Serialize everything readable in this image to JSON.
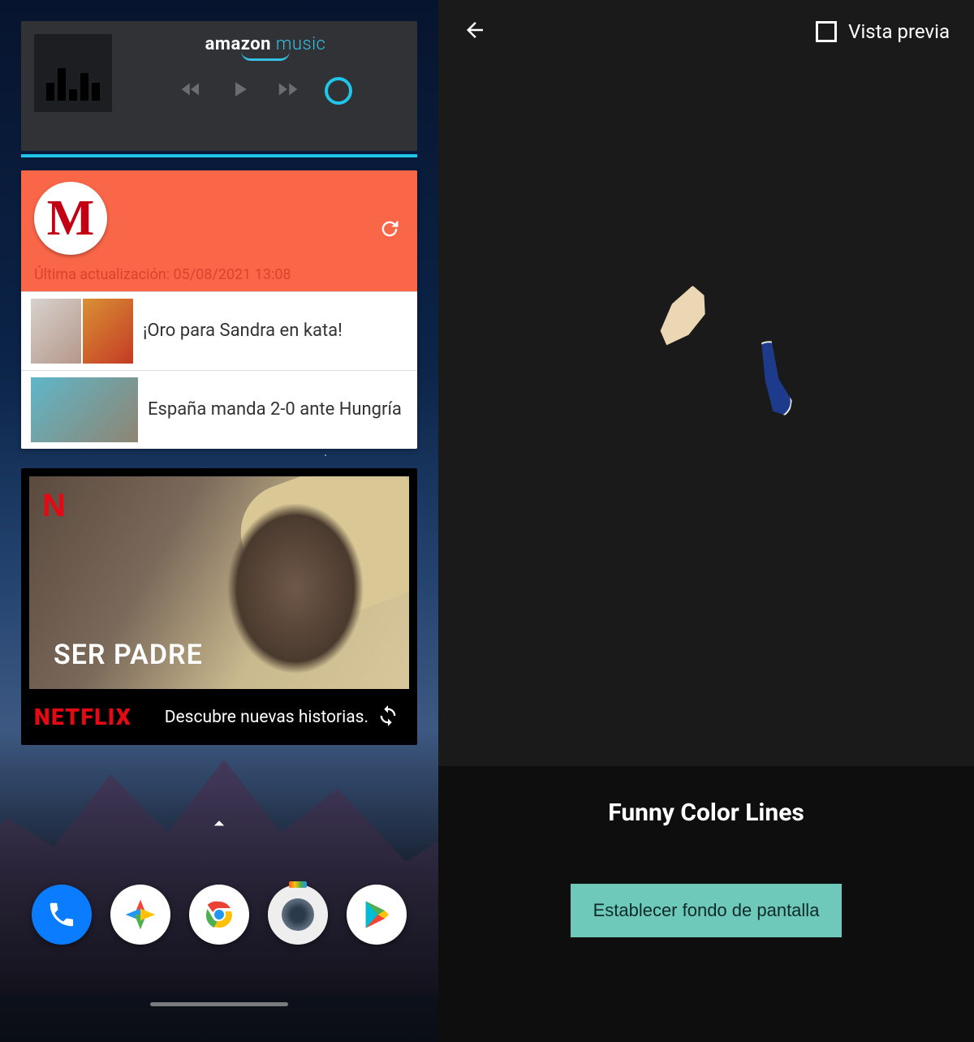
{
  "left": {
    "amazon": {
      "brand_a": "amazon",
      "brand_b": " music"
    },
    "marca": {
      "logo_letter": "M",
      "updated": "Última actualización: 05/08/2021 13:08",
      "items": [
        {
          "title": "¡Oro para Sandra en kata!"
        },
        {
          "title": "España manda 2-0 ante Hungría"
        }
      ]
    },
    "netflix": {
      "n": "N",
      "hero_title": "SER PADRE",
      "wordmark": "NETFLIX",
      "tagline": "Descubre nuevas historias."
    },
    "dock": [
      "phone",
      "photos",
      "chrome",
      "camera",
      "play"
    ]
  },
  "right": {
    "preview_label": "Vista previa",
    "title": "Funny Color Lines",
    "set_button": "Establecer fondo de pantalla"
  }
}
